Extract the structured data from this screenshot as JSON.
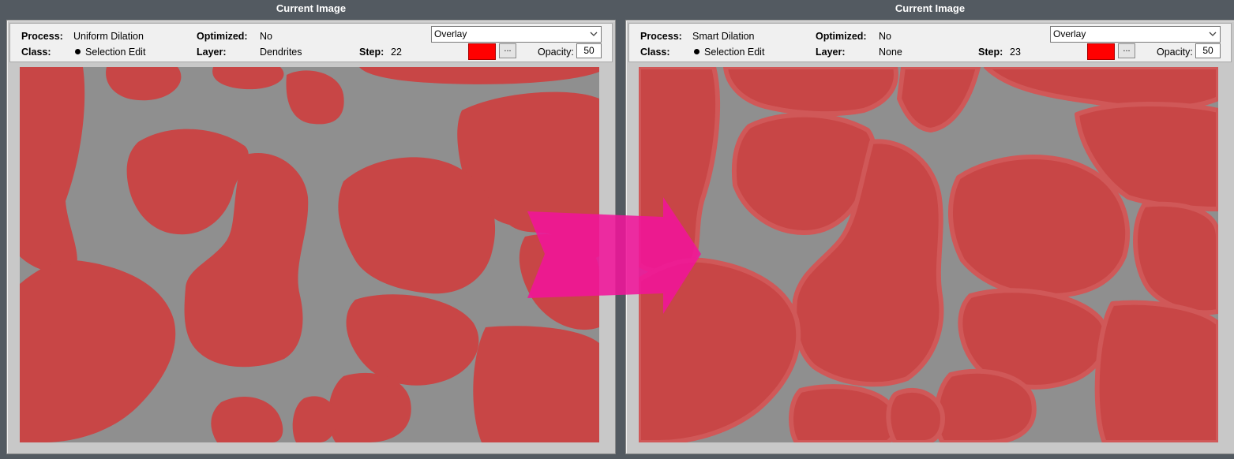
{
  "left_panel": {
    "title": "Current Image",
    "process_label": "Process:",
    "process_value": "Uniform Dilation",
    "optimized_label": "Optimized:",
    "optimized_value": "No",
    "class_label": "Class:",
    "class_value": "Selection Edit",
    "layer_label": "Layer:",
    "layer_value": "Dendrites",
    "step_label": "Step:",
    "step_value": "22",
    "display_mode": "Overlay",
    "overlay_color": "#ff0000",
    "color_button_label": "...",
    "opacity_label": "Opacity:",
    "opacity_value": "50"
  },
  "right_panel": {
    "title": "Current Image",
    "process_label": "Process:",
    "process_value": "Smart Dilation",
    "optimized_label": "Optimized:",
    "optimized_value": "No",
    "class_label": "Class:",
    "class_value": "Selection Edit",
    "layer_label": "Layer:",
    "layer_value": "None",
    "step_label": "Step:",
    "step_value": "23",
    "display_mode": "Overlay",
    "overlay_color": "#ff0000",
    "color_button_label": "...",
    "opacity_label": "Opacity:",
    "opacity_value": "50"
  },
  "colors": {
    "background": "#535a61",
    "overlay_red": "#c84646",
    "grain_gray": "#8f8f8f",
    "arrow_magenta": "#f0149a"
  },
  "icons": {
    "class_marker": "bullet-icon",
    "dropdown": "chevron-down-icon",
    "comparison": "arrow-right-icon"
  }
}
